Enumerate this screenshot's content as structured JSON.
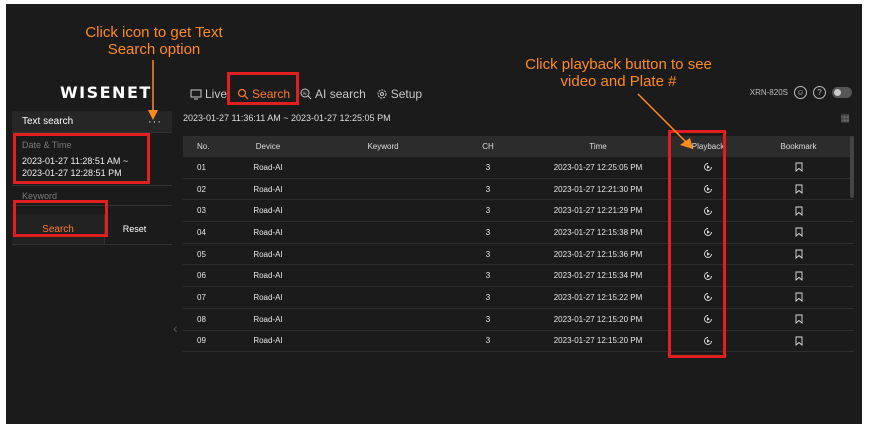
{
  "logo": "WISENET",
  "nav": [
    {
      "label": "Live",
      "icon": "monitor-icon"
    },
    {
      "label": "Search",
      "icon": "search-icon"
    },
    {
      "label": "AI search",
      "icon": "ai-search-icon"
    },
    {
      "label": "Setup",
      "icon": "gear-icon"
    }
  ],
  "device_model": "XRN-820S",
  "sidebar": {
    "title": "Text search",
    "more": "···",
    "date_label": "Date & Time",
    "date_from": "2023-01-27 11:28:51 AM ~",
    "date_to": "2023-01-27 12:28:51 PM",
    "keyword_label": "Keyword",
    "search_btn": "Search",
    "reset_btn": "Reset"
  },
  "range": "2023-01-27 11:36:11 AM ~ 2023-01-27 12:25:05 PM",
  "table": {
    "headers": [
      "No.",
      "Device",
      "Keyword",
      "CH",
      "Time",
      "Playback",
      "Bookmark"
    ],
    "rows": [
      {
        "no": "01",
        "device": "Road-AI",
        "keyword": "",
        "ch": "3",
        "time": "2023-01-27 12:25:05 PM"
      },
      {
        "no": "02",
        "device": "Road-AI",
        "keyword": "",
        "ch": "3",
        "time": "2023-01-27 12:21:30 PM"
      },
      {
        "no": "03",
        "device": "Road-AI",
        "keyword": "",
        "ch": "3",
        "time": "2023-01-27 12:21:29 PM"
      },
      {
        "no": "04",
        "device": "Road-AI",
        "keyword": "",
        "ch": "3",
        "time": "2023-01-27 12:15:38 PM"
      },
      {
        "no": "05",
        "device": "Road-AI",
        "keyword": "",
        "ch": "3",
        "time": "2023-01-27 12:15:36 PM"
      },
      {
        "no": "06",
        "device": "Road-AI",
        "keyword": "",
        "ch": "3",
        "time": "2023-01-27 12:15:34 PM"
      },
      {
        "no": "07",
        "device": "Road-AI",
        "keyword": "",
        "ch": "3",
        "time": "2023-01-27 12:15:22 PM"
      },
      {
        "no": "08",
        "device": "Road-AI",
        "keyword": "",
        "ch": "3",
        "time": "2023-01-27 12:15:20 PM"
      },
      {
        "no": "09",
        "device": "Road-AI",
        "keyword": "",
        "ch": "3",
        "time": "2023-01-27 12:15:20 PM"
      }
    ]
  },
  "annotations": {
    "text_search": "Click icon to get Text Search option",
    "playback": "Click playback button to see video and Plate #"
  },
  "colors": {
    "accent": "#ff7a2e",
    "highlight": "#e02020",
    "annotation": "#ff8c1a",
    "background": "#1b1b1b"
  }
}
